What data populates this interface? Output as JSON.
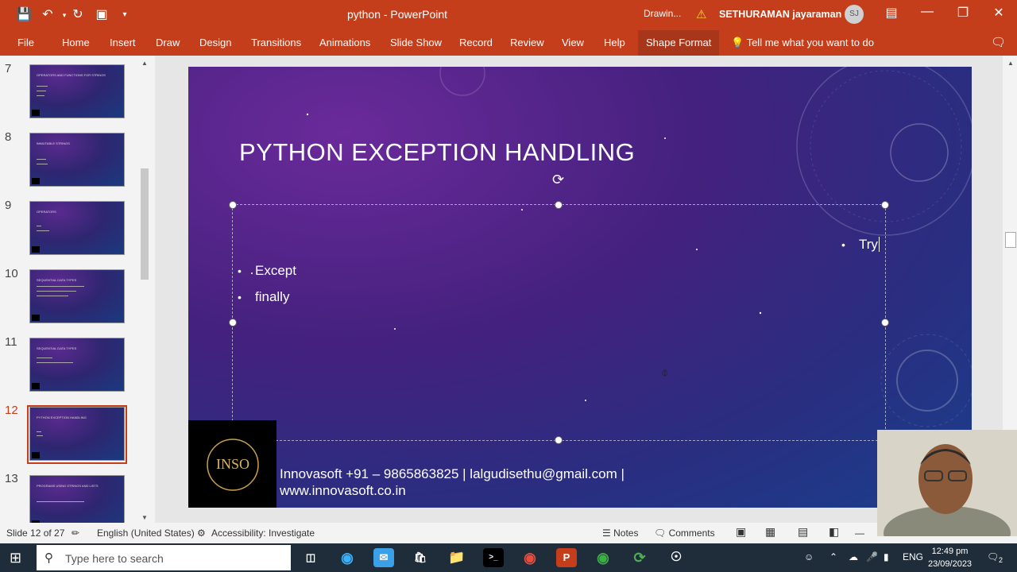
{
  "window": {
    "doc_title": "python  -  PowerPoint",
    "drawing_label": "Drawin...",
    "user_name": "SETHURAMAN jayaraman",
    "user_initials": "SJ"
  },
  "ribbon": {
    "tabs": [
      "File",
      "Home",
      "Insert",
      "Draw",
      "Design",
      "Transitions",
      "Animations",
      "Slide Show",
      "Record",
      "Review",
      "View",
      "Help",
      "Shape Format"
    ],
    "active_tab": "Shape Format",
    "tell_me": "Tell me what you want to do"
  },
  "thumbnails": {
    "items": [
      {
        "num": "7",
        "title": "OPERATORS AND FUNCTIONS FOR STRINGS"
      },
      {
        "num": "8",
        "title": "IMMUTABLE STRINGS"
      },
      {
        "num": "9",
        "title": "OPERATORS"
      },
      {
        "num": "10",
        "title": "SEQUENTIAL DATA TYPES"
      },
      {
        "num": "11",
        "title": "SEQUENTIAL DATA TYPES"
      },
      {
        "num": "12",
        "title": "PYTHON EXCEPTION HANDLING"
      },
      {
        "num": "13",
        "title": "PROGRAMS USING STRINGS AND LISTS"
      }
    ],
    "selected": "12"
  },
  "slide": {
    "title": "PYTHON EXCEPTION HANDLING",
    "bullet_try": "Try",
    "bullet_except": "Except",
    "bullet_finally": "finally",
    "footer_line1": "Innovasoft +91 – 9865863825 | lalgudisethu@gmail.com |",
    "footer_line2": "www.innovasoft.co.in",
    "logo_text": "INSO"
  },
  "status": {
    "slide_info": "Slide 12 of 27",
    "language": "English (United States)",
    "accessibility": "Accessibility: Investigate",
    "notes": "Notes",
    "comments": "Comments"
  },
  "taskbar": {
    "search_placeholder": "Type here to search",
    "lang": "ENG",
    "time": "12:49 pm",
    "date": "23/09/2023",
    "notification_count": "2"
  },
  "colors": {
    "accent": "#c43e1c",
    "slide_bg_start": "#6a2a9a",
    "slide_bg_end": "#1a3f8c"
  }
}
